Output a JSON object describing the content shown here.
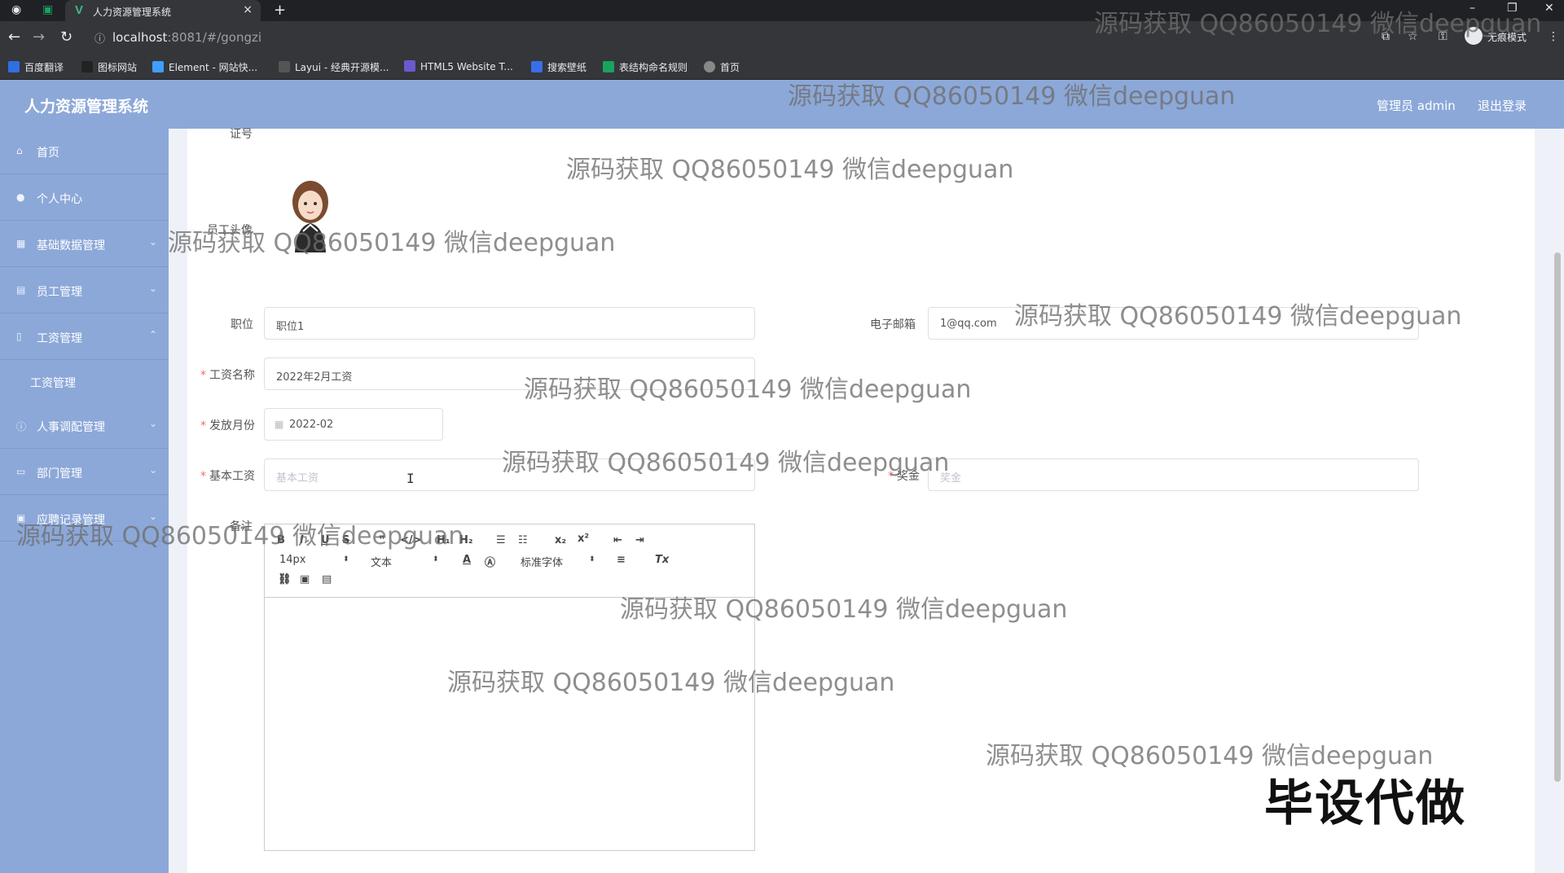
{
  "browser": {
    "tab_title": "人力资源管理系统",
    "tab_close": "×",
    "new_tab": "+",
    "url_host": "localhost",
    "url_rest": ":8081/#/gongzi",
    "incognito_label": "无痕模式",
    "bookmarks": [
      {
        "label": "百度翻译",
        "color": "#2f6fe4"
      },
      {
        "label": "图标网站",
        "color": "#222222"
      },
      {
        "label": "Element - 网站快...",
        "color": "#409eff"
      },
      {
        "label": "Layui - 经典开源模...",
        "color": "#555555"
      },
      {
        "label": "HTML5 Website T...",
        "color": "#6a5acd"
      },
      {
        "label": "搜索壁纸",
        "color": "#3a6ee8"
      },
      {
        "label": "表结构命名规则",
        "color": "#1aa260"
      },
      {
        "label": "首页",
        "color": "#888888"
      }
    ]
  },
  "header": {
    "app_title": "人力资源管理系统",
    "user": "管理员 admin",
    "logout": "退出登录"
  },
  "sidebar": {
    "items": [
      {
        "label": "首页",
        "icon": "home-icon"
      },
      {
        "label": "个人中心",
        "icon": "user-icon"
      },
      {
        "label": "基础数据管理",
        "icon": "table-icon"
      },
      {
        "label": "员工管理",
        "icon": "list-icon"
      },
      {
        "label": "工资管理",
        "icon": "tag-icon"
      },
      {
        "label": "人事调配管理",
        "icon": "info-icon"
      },
      {
        "label": "部门管理",
        "icon": "folder-icon"
      },
      {
        "label": "应聘记录管理",
        "icon": "record-icon"
      }
    ],
    "sub_items": [
      {
        "label": "工资管理"
      }
    ]
  },
  "form": {
    "id_label": "证号",
    "avatar_label": "员工头像",
    "position_label": "职位",
    "position_value": "职位1",
    "email_label": "电子邮箱",
    "email_value": "1@qq.com",
    "salary_name_label": "工资名称",
    "salary_name_value": "2022年2月工资",
    "month_label": "发放月份",
    "month_value": "2022-02",
    "base_salary_label": "基本工资",
    "base_salary_placeholder": "基本工资",
    "bonus_label": "奖金",
    "bonus_placeholder": "奖金",
    "remark_label": "备注"
  },
  "editor": {
    "font_size": "14px",
    "paragraph": "文本",
    "font_family": "标准字体"
  },
  "watermarks": {
    "text": "源码获取 QQ86050149 微信deepguan",
    "big": "毕设代做"
  }
}
